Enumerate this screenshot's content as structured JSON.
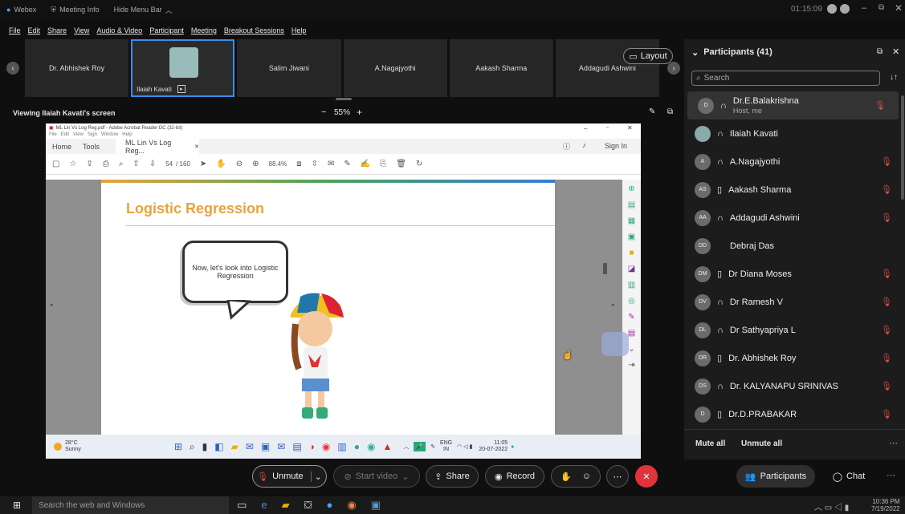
{
  "titlebar": {
    "app": "Webex",
    "meeting_info": "Meeting Info",
    "hide_menu": "Hide Menu Bar",
    "timer": "01:15:09"
  },
  "menu": [
    "File",
    "Edit",
    "Share",
    "View",
    "Audio & Video",
    "Participant",
    "Meeting",
    "Breakout Sessions",
    "Help"
  ],
  "video_tiles": [
    "Dr. Abhishek Roy",
    "Ilaiah Kavati",
    "Salim Jiwani",
    "A.Nagajyothi",
    "Aakash Sharma",
    "Addagudi Ashwini"
  ],
  "layout_label": "Layout",
  "viewing": "Viewing Ilaiah Kavati's screen",
  "zoom": "55%",
  "acrobat": {
    "title": "ML Lin Vs Log Reg.pdf - Adobe Acrobat Reader DC (32-bit)",
    "menu": [
      "File",
      "Edit",
      "View",
      "Sign",
      "Window",
      "Help"
    ],
    "tabs": [
      "Home",
      "Tools",
      "ML Lin Vs Log Reg..."
    ],
    "signin": "Sign In",
    "page": "54",
    "pages": "/ 160",
    "zoom": "88.4%"
  },
  "slide": {
    "title": "Logistic Regression",
    "bubble": "Now, let's look into Logistic Regression"
  },
  "remote_taskbar": {
    "temp": "28°C",
    "weather": "Sunny",
    "lang1": "ENG",
    "lang2": "IN",
    "time": "11:05",
    "date": "20-07-2022"
  },
  "controls": {
    "unmute": "Unmute",
    "start_video": "Start video",
    "share": "Share",
    "record": "Record",
    "participants": "Participants",
    "chat": "Chat"
  },
  "panel": {
    "title": "Participants (41)",
    "search_placeholder": "Search",
    "mute_all": "Mute all",
    "unmute_all": "Unmute all",
    "rows": [
      {
        "initials": "D",
        "name": "Dr.E.Balakrishna",
        "sub": "Host, me",
        "device": "headset",
        "muted": true
      },
      {
        "initials": "",
        "name": "Ilaiah Kavati",
        "sub": "",
        "device": "headset",
        "muted": false
      },
      {
        "initials": "A",
        "name": "A.Nagajyothi",
        "sub": "",
        "device": "headset",
        "muted": true
      },
      {
        "initials": "AS",
        "name": "Aakash Sharma",
        "sub": "",
        "device": "phone",
        "muted": true
      },
      {
        "initials": "AA",
        "name": "Addagudi Ashwini",
        "sub": "",
        "device": "headset",
        "muted": true
      },
      {
        "initials": "DD",
        "name": "Debraj Das",
        "sub": "",
        "device": "",
        "muted": false
      },
      {
        "initials": "DM",
        "name": "Dr Diana Moses",
        "sub": "",
        "device": "phone",
        "muted": true
      },
      {
        "initials": "DV",
        "name": "Dr Ramesh V",
        "sub": "",
        "device": "headset",
        "muted": true
      },
      {
        "initials": "DL",
        "name": "Dr Sathyapriya L",
        "sub": "",
        "device": "headset",
        "muted": true
      },
      {
        "initials": "DR",
        "name": "Dr. Abhishek Roy",
        "sub": "",
        "device": "phone",
        "muted": true
      },
      {
        "initials": "DS",
        "name": "Dr. KALYANAPU SRINIVAS",
        "sub": "",
        "device": "headset",
        "muted": true
      },
      {
        "initials": "D",
        "name": "Dr.D.PRABAKAR",
        "sub": "",
        "device": "phone",
        "muted": true
      }
    ]
  },
  "win_taskbar": {
    "search": "Search the web and Windows",
    "time": "10:36 PM",
    "date": "7/19/2022"
  }
}
